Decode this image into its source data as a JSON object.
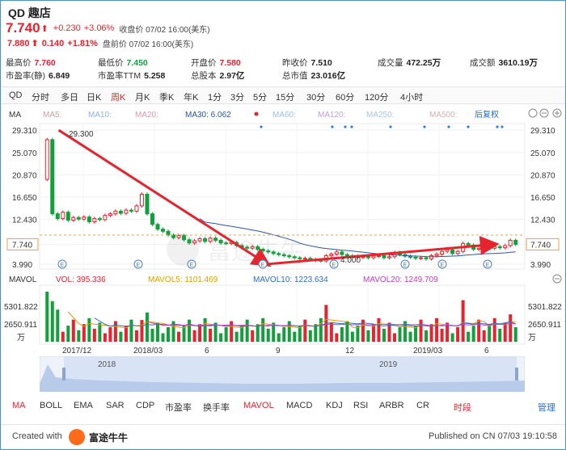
{
  "stock": {
    "title": "QD 趣店",
    "price": "7.740",
    "arrow": "⬆",
    "change": "+0.230",
    "change_pct": "+3.06%",
    "close_label": "收盘价 07/02 16:00(美东)",
    "pre_price": "7.880",
    "pre_arrow": "⬆",
    "pre_change": "0.140",
    "pre_change_pct": "+1.81%",
    "pre_label": "盘前价 07/02 16:00(美东)"
  },
  "stats": [
    {
      "k": "最高价",
      "v": "7.760",
      "color": "#e6242d"
    },
    {
      "k": "最低价",
      "v": "7.450",
      "color": "#13a03c"
    },
    {
      "k": "开盘价",
      "v": "7.580",
      "color": "#e6242d"
    },
    {
      "k": "昨收价",
      "v": "7.510",
      "color": "#222"
    },
    {
      "k": "成交量",
      "v": "472.25万",
      "color": "#222"
    },
    {
      "k": "成交额",
      "v": "3610.19万",
      "color": "#222"
    },
    {
      "k": "市盈率(静)",
      "v": "6.849",
      "color": "#222"
    },
    {
      "k": "市盈率TTM",
      "v": "5.258",
      "color": "#222"
    },
    {
      "k": "总股本",
      "v": "2.97亿",
      "color": "#222"
    },
    {
      "k": "总市值",
      "v": "23.016亿",
      "color": "#222"
    }
  ],
  "periods": [
    "QD",
    "分时",
    "多日",
    "日K",
    "周K",
    "月K",
    "季K",
    "年K",
    "1分",
    "3分",
    "5分",
    "15分",
    "30分",
    "60分",
    "120分",
    "4小时"
  ],
  "active_period": "周K",
  "ma_legend": {
    "label": "MA",
    "items": [
      "MA5:",
      "MA10:",
      "MA20:",
      "MA30: 6.062",
      "MA60:",
      "MA120:",
      "MA250:",
      "MA500:"
    ],
    "adjust": "后复权",
    "colors": [
      "#c8a0a0",
      "#8fb3e0",
      "#d89aaf",
      "#2a55a8",
      "#9ac0e8",
      "#c0a0d8",
      "#a9c4e8",
      "#d0b0b0"
    ]
  },
  "price_axis": {
    "left": [
      "29.310",
      "25.070",
      "20.870",
      "16.650",
      "12.430",
      "7.740",
      "3.990"
    ],
    "right": [
      "29.310",
      "25.070",
      "20.870",
      "16.650",
      "12.430",
      "7.740",
      "3.990"
    ],
    "annotations": {
      "high": "29.300",
      "low": "4.000"
    }
  },
  "vol_legend": {
    "label": "MAVOL",
    "items": [
      "VOL: 395.336",
      "MAVOL5: 1101.469",
      "MAVOL10: 1223.634",
      "MAVOL20: 1249.709"
    ],
    "colors": [
      "#e6242d",
      "#e0a000",
      "#2a6bd0",
      "#c040c0"
    ]
  },
  "vol_axis": {
    "top": "5301.822",
    "mid": "2650.911",
    "unit": "万"
  },
  "x_axis": [
    "2017/12",
    "2018/03",
    "6",
    "9",
    "12",
    "2019/03",
    "6"
  ],
  "navigator": {
    "labels": [
      "2018",
      "2019"
    ]
  },
  "indicators": [
    "MA",
    "BOLL",
    "EMA",
    "SAR",
    "CDP",
    "市盈率",
    "换手率",
    "MAVOL",
    "MACD",
    "KDJ",
    "RSI",
    "ARBR",
    "CR",
    "时段"
  ],
  "active_indicators": [
    "MA",
    "MAVOL"
  ],
  "manage": "管理",
  "footer": {
    "created": "Created with",
    "brand": "富途牛牛",
    "published": "Published on CN 07/03 19:10:58"
  },
  "chart_data": {
    "type": "candlestick",
    "x_range": [
      "2017/10",
      "2019/07"
    ],
    "ylim": [
      3.99,
      29.31
    ],
    "closes": [
      27.5,
      13.5,
      12.6,
      13.8,
      12.3,
      12.8,
      12.5,
      12.9,
      12.0,
      12.6,
      12.4,
      13.2,
      13.5,
      14.0,
      13.6,
      14.2,
      14.0,
      15.0,
      17.2,
      13.5,
      11.5,
      10.6,
      10.2,
      9.5,
      9.0,
      9.4,
      8.6,
      8.0,
      8.4,
      8.8,
      8.3,
      8.9,
      8.5,
      8.0,
      7.9,
      8.1,
      7.5,
      7.2,
      7.0,
      7.3,
      6.8,
      6.5,
      6.3,
      6.0,
      5.8,
      5.6,
      5.4,
      5.2,
      5.0,
      5.1,
      4.9,
      4.7,
      4.6,
      5.6,
      5.9,
      6.3,
      5.8,
      5.6,
      5.5,
      5.3,
      5.4,
      5.2,
      5.5,
      5.6,
      5.2,
      5.4,
      6.2,
      5.8,
      5.5,
      5.3,
      5.1,
      5.2,
      5.0,
      5.6,
      5.9,
      6.4,
      6.7,
      6.0,
      6.4,
      7.9,
      7.6,
      6.8,
      7.0,
      7.4,
      7.0,
      7.3,
      7.1,
      7.5,
      8.5,
      7.74
    ],
    "volume_max": 5301.822,
    "trend_lines": [
      {
        "from": [
          0.03,
          29.3
        ],
        "to": [
          0.47,
          4.0
        ]
      },
      {
        "from": [
          0.47,
          4.0
        ],
        "to": [
          0.95,
          7.74
        ]
      }
    ]
  }
}
